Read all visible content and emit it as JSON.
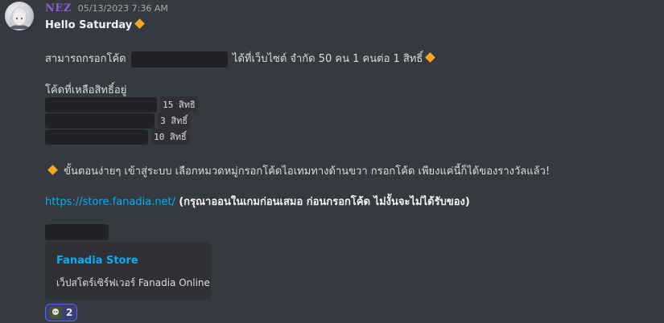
{
  "author": {
    "name": "NEZ",
    "color": "#8e5fd4"
  },
  "timestamp": "05/13/2023 7:36 AM",
  "greeting": "Hello Saturday",
  "line1": {
    "before": "สามารถกรอกโค้ด",
    "after": "ได้ที่เว็บไซต์ จำกัด 50 คน 1 คนต่อ 1 สิทธิ์"
  },
  "codes_title": "โค้ดที่เหลือสิทธิ์อยู่",
  "codes": [
    {
      "count": "15 สิทธิ"
    },
    {
      "count": "3 สิทธิ์"
    },
    {
      "count": "10 สิทธิ์"
    }
  ],
  "steps": "ขั้นตอนง่ายๆ เข้าสู่ระบบ เลือกหมวดหมู่กรอกโค้ดไอเทมทางด้านขวา กรอกโค้ด เพียงแค่นี้ก็ได้ของรางวัลแล้ว!",
  "link": {
    "url": "https://store.fanadia.net/",
    "note": "(กรุณาออนในเกมก่อนเสมอ ก่อนกรอกโค้ด ไม่งั้นจะไม่ได้รับของ)"
  },
  "embed": {
    "title": "Fanadia Store",
    "description": "เว็ปสโตร์เซิร์ฟเวอร์ Fanadia Online"
  },
  "reaction": {
    "count": "2"
  },
  "colors": {
    "background": "#36393f",
    "link": "#00aff4",
    "accent_diamond": "#f5a623",
    "spoiler": "#202225"
  },
  "icons": [
    "avatar-image",
    "orange-diamond-icon",
    "reaction-emoji-icon"
  ]
}
